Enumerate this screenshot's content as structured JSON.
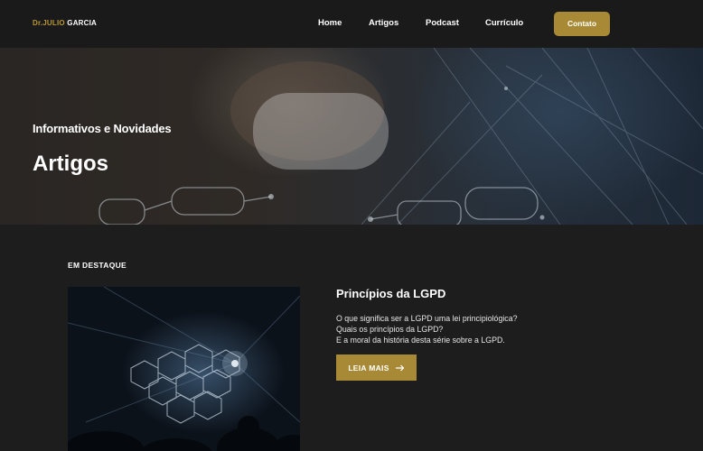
{
  "header": {
    "logo_prefix": "Dr.JULIO",
    "logo_name": "GARCIA",
    "nav": [
      {
        "label": "Home"
      },
      {
        "label": "Artigos"
      },
      {
        "label": "Podcast"
      },
      {
        "label": "Currículo"
      }
    ],
    "contact_label": "Contato"
  },
  "hero": {
    "subtitle": "Informativos e Novidades",
    "title": "Artigos"
  },
  "featured": {
    "label": "EM DESTAQUE",
    "post_title": "Princípios da LGPD",
    "excerpt": [
      "O que significa ser a LGPD uma lei principiológica?",
      "Quais os princípios da LGPD?",
      "E a moral da história desta série sobre a LGPD."
    ],
    "read_more_label": "LEIA MAIS",
    "read_more_icon": "arrow-right-icon"
  },
  "colors": {
    "accent": "#a88a36",
    "logo_accent": "#b8963a",
    "background": "#1d1d1d"
  }
}
